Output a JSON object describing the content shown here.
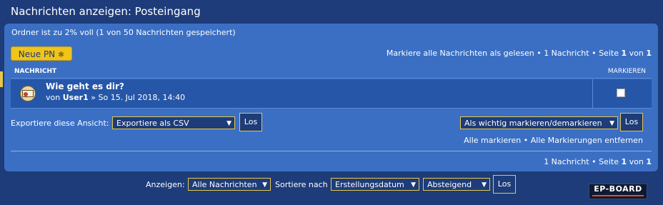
{
  "page": {
    "title": "Nachrichten anzeigen: Posteingang"
  },
  "folder": {
    "usage": "Ordner ist zu 2% voll (1 von 50 Nachrichten gespeichert)"
  },
  "toolbar": {
    "new_pm_label": "Neue PN",
    "new_pm_icon": "star-icon",
    "mark_read": "Markiere alle Nachrichten als gelesen",
    "message_count": "1 Nachricht",
    "page_label": "Seite",
    "page_current": "1",
    "page_of": "von",
    "page_total": "1"
  },
  "table": {
    "col_message": "NACHRICHT",
    "col_mark": "MARKIEREN",
    "rows": [
      {
        "subject": "Wie geht es dir?",
        "by": "von",
        "author": "User1",
        "sep": "»",
        "date": "So 15. Jul 2018, 14:40",
        "icon": "unread-message-icon",
        "checked": false
      }
    ]
  },
  "export": {
    "label": "Exportiere diese Ansicht:",
    "selected": "Exportiere als CSV",
    "go": "Los"
  },
  "mark_action": {
    "selected": "Als wichtig markieren/demarkieren",
    "go": "Los",
    "mark_all": "Alle markieren",
    "separator": "•",
    "unmark_all": "Alle Markierungen entfernen"
  },
  "bottom_pagination": {
    "message_count": "1 Nachricht",
    "page_label": "Seite",
    "page_current": "1",
    "page_of": "von",
    "page_total": "1"
  },
  "footer": {
    "show_label": "Anzeigen:",
    "show_selected": "Alle Nachrichten",
    "sort_label": "Sortiere nach",
    "sort_selected": "Erstellungsdatum",
    "order_selected": "Absteigend",
    "go": "Los"
  },
  "logo": {
    "text": "EP-BOARD"
  },
  "colors": {
    "background": "#1d3c79",
    "panel": "#3b6fc4",
    "row": "#2556a8",
    "accent": "#f0c419"
  }
}
